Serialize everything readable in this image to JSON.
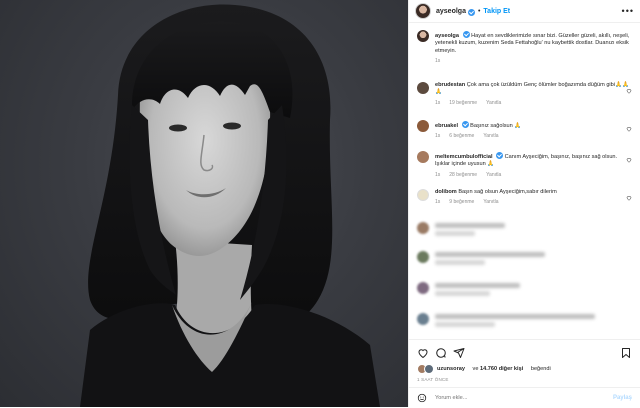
{
  "header": {
    "username": "ayseolga",
    "follow_label": "Takip Et",
    "separator": "•",
    "more_label": "•••"
  },
  "caption": {
    "username": "ayseolga",
    "text": "Hayat en sevdiklerimizle sınar bizi. Güzeller güzeli, akıllı, neşeli, yetenekli kuzum, kuzenim Seda Fettahoğlu' nu kaybettik dostlar. Duanızı eksik etmeyin.",
    "time": "1s"
  },
  "comments": [
    {
      "username": "ebrudestan",
      "verified": false,
      "text": "Çok ama çok üzüldüm Genç ölümler boğazımda düğüm gibi🙏🙏🙏",
      "time": "1s",
      "likes": "19 beğenme",
      "reply": "Yanıtla"
    },
    {
      "username": "ebruakel",
      "verified": true,
      "text": "Başınız sağolsun 🙏",
      "time": "1s",
      "likes": "6 beğenme",
      "reply": "Yanıtla"
    },
    {
      "username": "meltemcumbulofficial",
      "verified": true,
      "text": "Canım Ayşeciğim, başınız, başınız sağ olsun. Işıklar içinde uyusun 🙏",
      "time": "1s",
      "likes": "28 beğenme",
      "reply": "Yanıtla"
    },
    {
      "username": "dolibom",
      "verified": false,
      "text": "Başın sağ olsun Ayşeciğim,sabır dilerim",
      "time": "1s",
      "likes": "9 beğenme",
      "reply": "Yanıtla"
    }
  ],
  "footer": {
    "liked_by_user": "uzunsoray",
    "liked_by_text": "ve",
    "liked_by_count": "14.760 diğer kişi",
    "liked_suffix": "beğendi",
    "date": "1 SAAT ÖNCE",
    "comment_placeholder": "Yorum ekle...",
    "share_label": "Paylaş"
  },
  "colors": {
    "link": "#0095f6",
    "verified": "#3797f0",
    "muted": "#8e8e8e"
  }
}
